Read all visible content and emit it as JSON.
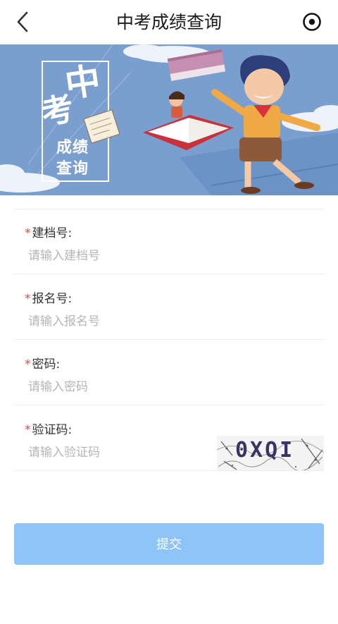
{
  "header": {
    "title": "中考成绩查询",
    "back_icon": "chevron-left-icon",
    "menu_icon": "target-icon"
  },
  "banner": {
    "line1": "中",
    "line2": "考",
    "line3": "成绩",
    "line4": "查询",
    "colors": {
      "sky": "#7a9fcf",
      "cloud": "#eef3fb",
      "book_red": "#c9313b",
      "book_pink": "#c58fb1"
    }
  },
  "form": {
    "required_mark": "*",
    "fields": [
      {
        "label": "建档号:",
        "placeholder": "请输入建档号"
      },
      {
        "label": "报名号:",
        "placeholder": "请输入报名号"
      },
      {
        "label": "密码:",
        "placeholder": "请输入密码"
      },
      {
        "label": "验证码:",
        "placeholder": "请输入验证码"
      }
    ],
    "captcha": {
      "text": "0XQI"
    }
  },
  "submit": {
    "label": "提交",
    "color": "#8fc4f8"
  },
  "colors": {
    "required": "#e04646",
    "placeholder": "#b5b5b5",
    "divider": "#ececec"
  }
}
